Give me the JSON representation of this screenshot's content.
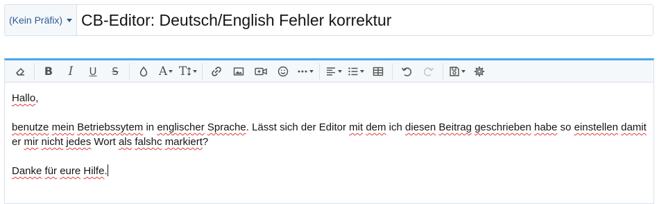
{
  "title_row": {
    "prefix_label": "(Kein Präfix)",
    "title_value": "CB-Editor: Deutsch/English Fehler korrektur"
  },
  "colors": {
    "accent_top_border": "#47a7eb",
    "prefix_text": "#2b5a93",
    "spellcheck_underline": "#e03b3b"
  },
  "toolbar": {
    "buttons": [
      {
        "name": "eraser-icon"
      },
      {
        "name": "bold-icon",
        "glyph": "B"
      },
      {
        "name": "italic-icon",
        "glyph": "I"
      },
      {
        "name": "underline-icon",
        "glyph": "U"
      },
      {
        "name": "strikethrough-icon",
        "glyph": "S"
      },
      {
        "name": "text-color-icon"
      },
      {
        "name": "font-family-icon",
        "glyph": "A"
      },
      {
        "name": "font-size-icon",
        "glyph": "T"
      },
      {
        "name": "link-icon"
      },
      {
        "name": "image-icon"
      },
      {
        "name": "media-icon"
      },
      {
        "name": "smilie-icon"
      },
      {
        "name": "more-options-icon"
      },
      {
        "name": "align-icon"
      },
      {
        "name": "list-icon"
      },
      {
        "name": "table-icon"
      },
      {
        "name": "undo-icon"
      },
      {
        "name": "redo-icon"
      },
      {
        "name": "drafts-icon"
      },
      {
        "name": "settings-icon"
      }
    ]
  },
  "content": {
    "line1": [
      "Hallo",
      ","
    ],
    "line2": {
      "w": [
        "benutze",
        " ",
        "mein",
        " ",
        "Betriebssytem",
        " in ",
        "englischer",
        " ",
        "Sprache",
        ". Lässt sich der Editor ",
        "mit",
        " ",
        "dem",
        " ich ",
        "diesen",
        " ",
        "Beitrag",
        " ",
        "geschrieben",
        " ",
        "habe",
        " so ",
        "einstellen",
        " ",
        "damit",
        " er ",
        "mir",
        " ",
        "nicht",
        " ",
        "jedes",
        " Wort ",
        "als",
        " ",
        "falshc",
        " ",
        "markiert",
        "?"
      ]
    },
    "line3": [
      "Danke",
      " ",
      "für",
      " ",
      "eure",
      " ",
      "Hilfe",
      "."
    ]
  }
}
